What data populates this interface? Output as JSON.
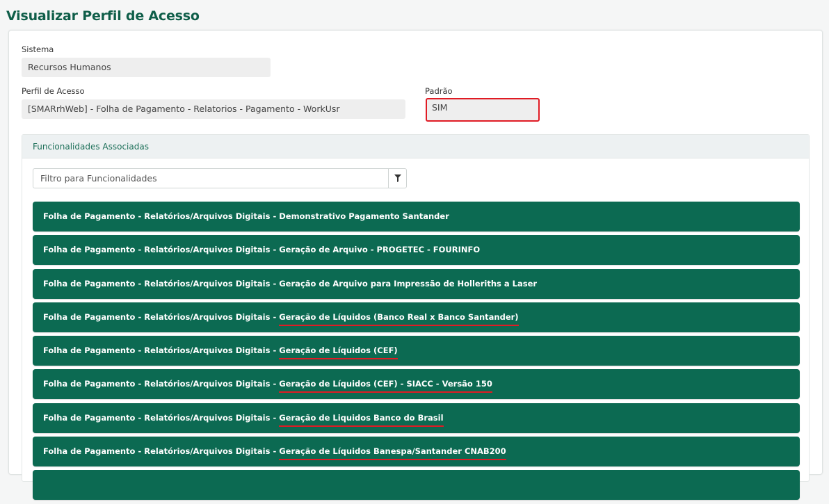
{
  "page": {
    "title": "Visualizar Perfil de Acesso"
  },
  "form": {
    "sistema_label": "Sistema",
    "sistema_value": "Recursos Humanos",
    "perfil_label": "Perfil de Acesso",
    "perfil_value": "[SMARrhWeb] - Folha de Pagamento - Relatorios - Pagamento - WorkUsr",
    "padrao_label": "Padrão",
    "padrao_value": "SIM"
  },
  "panel": {
    "header": "Funcionalidades Associadas",
    "filter_placeholder": "Filtro para Funcionalidades",
    "items": [
      {
        "prefix": "Folha de Pagamento - Relatórios/Arquivos Digitais - ",
        "name": "Demonstrativo Pagamento Santander"
      },
      {
        "prefix": "Folha de Pagamento - Relatórios/Arquivos Digitais - ",
        "name": "Geração de Arquivo - PROGETEC - FOURINFO"
      },
      {
        "prefix": "Folha de Pagamento - Relatórios/Arquivos Digitais - ",
        "name": "Geração de Arquivo para Impressão de Holleriths a Laser"
      },
      {
        "prefix": "Folha de Pagamento - Relatórios/Arquivos Digitais - ",
        "name": "Geração de Líquidos (Banco Real x Banco Santander)"
      },
      {
        "prefix": "Folha de Pagamento - Relatórios/Arquivos Digitais - ",
        "name": "Geração de Líquidos (CEF)"
      },
      {
        "prefix": "Folha de Pagamento - Relatórios/Arquivos Digitais - ",
        "name": "Geração de Líquidos (CEF) - SIACC - Versão 150"
      },
      {
        "prefix": "Folha de Pagamento - Relatórios/Arquivos Digitais - ",
        "name": "Geração de Liquidos Banco do Brasil"
      },
      {
        "prefix": "Folha de Pagamento - Relatórios/Arquivos Digitais - ",
        "name": "Geração de Líquidos Banespa/Santander CNAB200"
      }
    ]
  },
  "colors": {
    "brand": "#0c6a52",
    "title": "#0f5e49",
    "highlight": "#e01b24"
  },
  "icons": {
    "filter_button": "filter-icon"
  }
}
